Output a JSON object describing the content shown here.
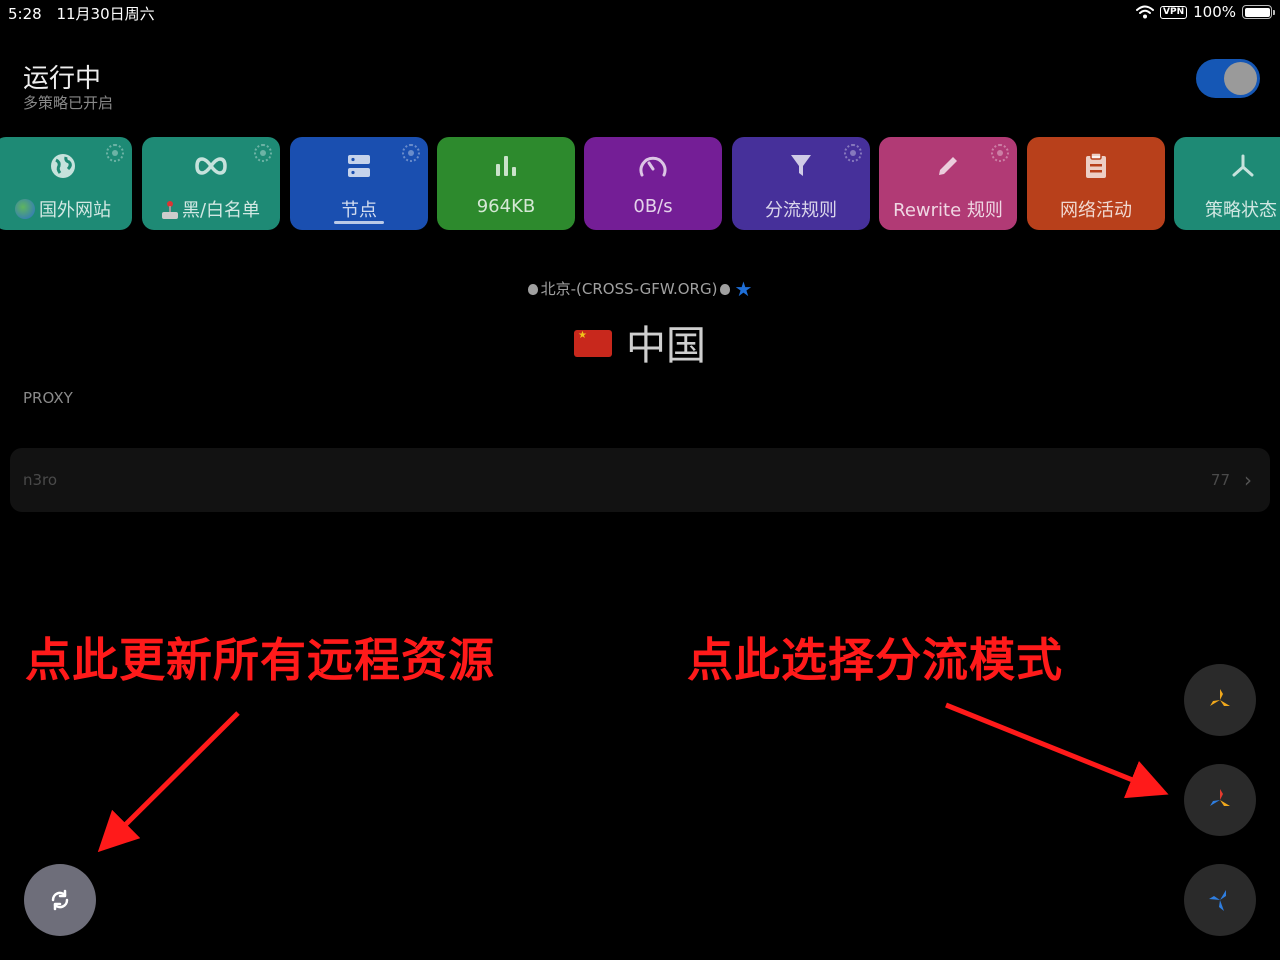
{
  "status_bar": {
    "time": "5:28",
    "date": "11月30日周六",
    "vpn": "VPN",
    "battery": "100%"
  },
  "header": {
    "title": "运行中",
    "subtitle": "多策略已开启",
    "toggle_on": true
  },
  "tiles": [
    {
      "label": "国外网站",
      "icon": "globe-icon",
      "color": "#1c8c78",
      "emoji": "globe"
    },
    {
      "label": "黑/白名单",
      "icon": "infinity-icon",
      "color": "#1c8c78",
      "emoji": "joystick"
    },
    {
      "label": "节点",
      "icon": "server-icon",
      "color": "#1a4fb3"
    },
    {
      "label": "964KB",
      "icon": "bar-chart-icon",
      "color": "#2f8f2f"
    },
    {
      "label": "0B/s",
      "icon": "speedometer-icon",
      "color": "#7a1f9c"
    },
    {
      "label": "分流规则",
      "icon": "filter-icon",
      "color": "#4a2f9e"
    },
    {
      "label": "Rewrite 规则",
      "icon": "pencil-icon",
      "color": "#b83a78"
    },
    {
      "label": "网络活动",
      "icon": "clipboard-icon",
      "color": "#c0441c"
    },
    {
      "label": "策略状态",
      "icon": "branch-icon",
      "color": "#1c8c78"
    }
  ],
  "node": {
    "name": "北京-(CROSS-GFW.ORG)",
    "country": "中国"
  },
  "section": {
    "label": "PROXY"
  },
  "proxy": {
    "name": "n3ro",
    "count": "77"
  },
  "annotations": {
    "left": "点此更新所有远程资源",
    "right": "点此选择分流模式"
  }
}
